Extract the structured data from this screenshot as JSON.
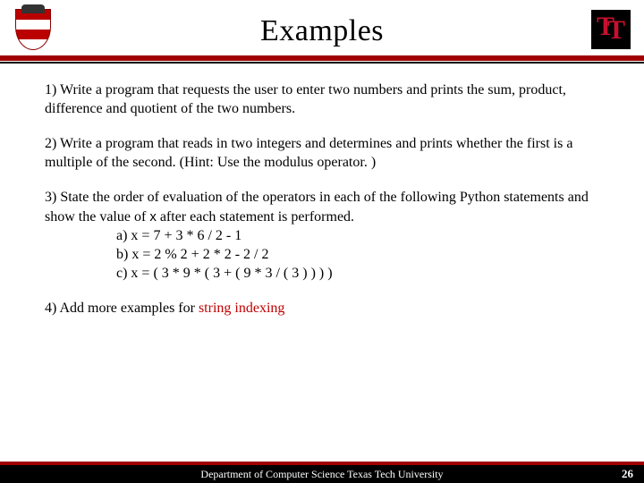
{
  "slide": {
    "title": "Examples",
    "q1": "1) Write a program that requests the user to enter two numbers and prints the sum, product, difference and quotient of the two numbers.",
    "q2": "2) Write a program that reads in two integers and determines and prints whether the first is a multiple of the second. (Hint: Use the modulus operator. )",
    "q3_lead": "3) State the order of evaluation of the operators in each of the following Python statements and show the value of ",
    "q3_x": "x",
    "q3_tail": " after each statement is performed.",
    "q3a": "a) x = 7 + 3 * 6 / 2 - 1",
    "q3b": "b) x = 2 % 2 + 2 * 2 - 2 / 2",
    "q3c": "c) x = ( 3 * 9 * ( 3 + ( 9 * 3 / ( 3 ) ) ) )",
    "q4_lead": "4) Add more examples for ",
    "q4_red": "string indexing",
    "footer": "Department of Computer Science Texas Tech University",
    "page": "26"
  }
}
